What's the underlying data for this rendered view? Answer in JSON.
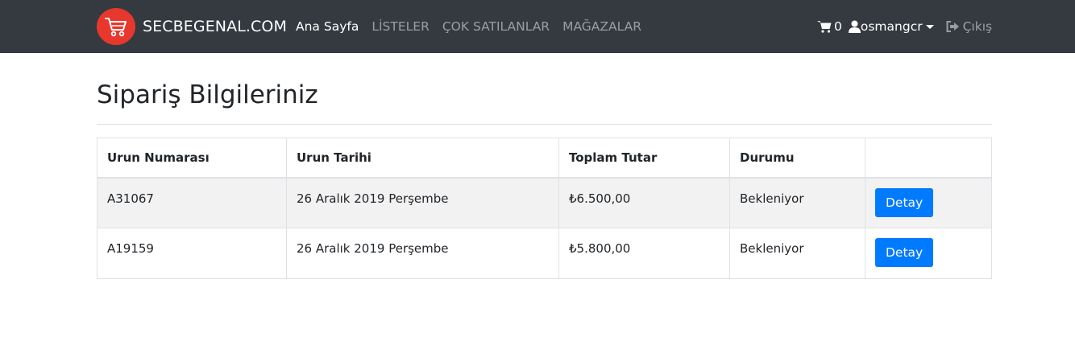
{
  "navbar": {
    "brand": "SECBEGENAL.COM",
    "links": [
      {
        "label": "Ana Sayfa",
        "active": true
      },
      {
        "label": "LİSTELER",
        "active": false
      },
      {
        "label": "ÇOK SATILANLAR",
        "active": false
      },
      {
        "label": "MAĞAZALAR",
        "active": false
      }
    ],
    "cart_count": "0",
    "username": "osmangcr",
    "logout_label": "Çıkış"
  },
  "page": {
    "title": "Sipariş Bilgileriniz"
  },
  "orders": {
    "headers": [
      "Urun Numarası",
      "Urun Tarihi",
      "Toplam Tutar",
      "Durumu",
      ""
    ],
    "rows": [
      {
        "number": "A31067",
        "date": "26 Aralık 2019 Perşembe",
        "total": "₺6.500,00",
        "status": "Bekleniyor",
        "action": "Detay"
      },
      {
        "number": "A19159",
        "date": "26 Aralık 2019 Perşembe",
        "total": "₺5.800,00",
        "status": "Bekleniyor",
        "action": "Detay"
      }
    ]
  },
  "colors": {
    "navbar_bg": "#343a40",
    "logo_bg": "#e8372d",
    "primary_button": "#007bff",
    "striped_row": "#f2f2f2"
  }
}
